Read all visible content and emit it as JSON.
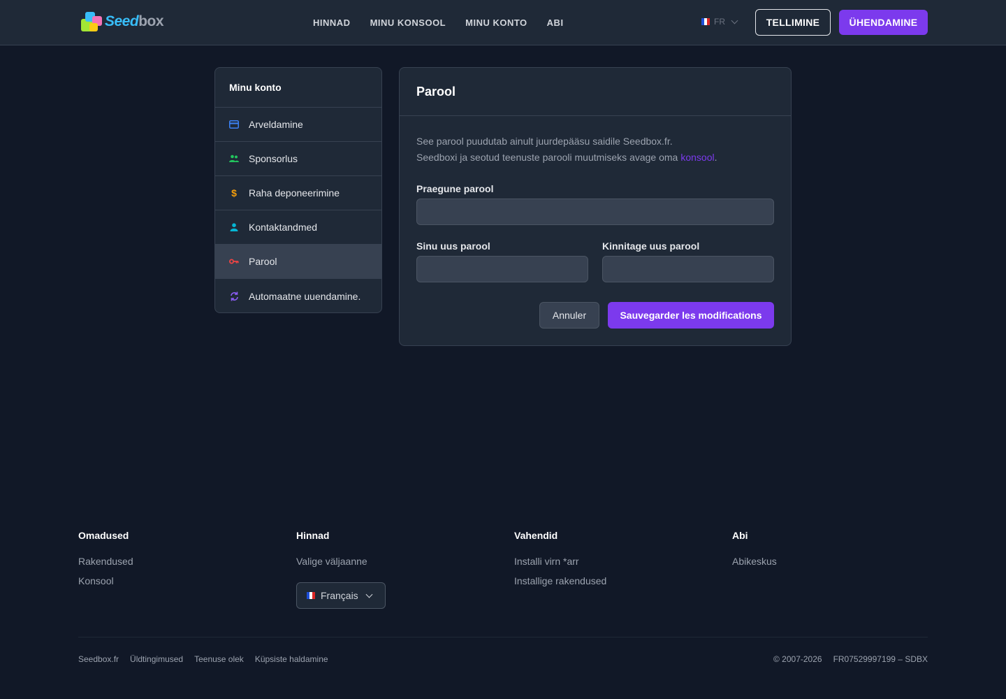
{
  "header": {
    "brand_seed": "Seed",
    "brand_box": "box",
    "nav": [
      "HINNAD",
      "MINU KONSOOL",
      "MINU KONTO",
      "ABI"
    ],
    "lang_code": "FR",
    "order_label": "TELLIMINE",
    "login_label": "ÜHENDAMINE"
  },
  "sidebar": {
    "title": "Minu konto",
    "items": [
      {
        "label": "Arveldamine",
        "icon": "credit-card-icon",
        "color": "#3b82f6"
      },
      {
        "label": "Sponsorlus",
        "icon": "users-icon",
        "color": "#22c55e"
      },
      {
        "label": "Raha deponeerimine",
        "icon": "dollar-icon",
        "color": "#f59e0b"
      },
      {
        "label": "Kontaktandmed",
        "icon": "user-icon",
        "color": "#06b6d4"
      },
      {
        "label": "Parool",
        "icon": "key-icon",
        "color": "#ef4444",
        "active": true
      },
      {
        "label": "Automaatne uuendamine.",
        "icon": "refresh-icon",
        "color": "#8b5cf6"
      }
    ]
  },
  "card": {
    "title": "Parool",
    "desc_line1": "See parool puudutab ainult juurdepääsu saidile Seedbox.fr.",
    "desc_line2": "Seedboxi ja seotud teenuste parooli muutmiseks avage oma",
    "desc_link": "konsool",
    "desc_end": ".",
    "current_label": "Praegune parool",
    "new_label": "Sinu uus parool",
    "confirm_label": "Kinnitage uus parool",
    "current_value": "",
    "new_value": "",
    "confirm_value": "",
    "cancel_label": "Annuler",
    "save_label": "Sauvegarder les modifications"
  },
  "footer": {
    "columns": [
      {
        "title": "Omadused",
        "links": [
          "Rakendused",
          "Konsool"
        ]
      },
      {
        "title": "Hinnad",
        "links": [
          "Valige väljaanne"
        ]
      },
      {
        "title": "Vahendid",
        "links": [
          "Installi virn *arr",
          "Installige rakendused"
        ]
      },
      {
        "title": "Abi",
        "links": [
          "Abikeskus"
        ]
      }
    ],
    "language": "Français",
    "bottom_links": [
      "Seedbox.fr",
      "Üldtingimused",
      "Teenuse olek",
      "Küpsiste haldamine"
    ],
    "copyright": "© 2007-2026",
    "company_id": "FR07529997199 – SDBX"
  },
  "colors": {
    "accent": "#7c3aed",
    "background": "#111827",
    "surface": "#1f2937"
  }
}
